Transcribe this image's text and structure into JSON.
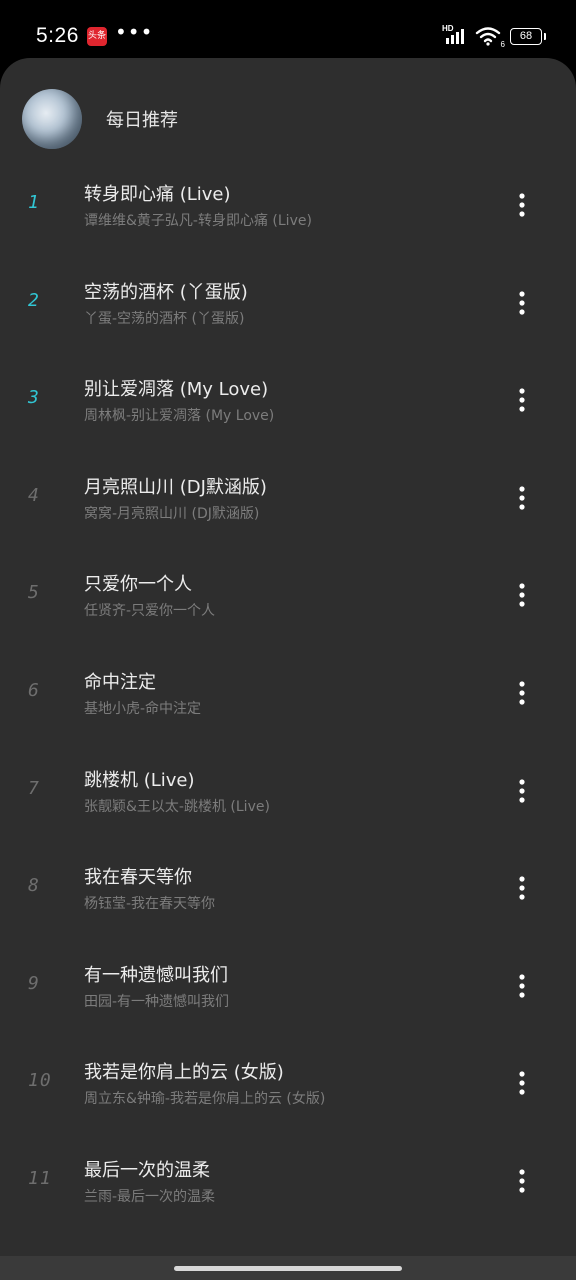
{
  "status_bar": {
    "time": "5:26",
    "app_icon_text": "头条",
    "dots": "•••",
    "network_label": "HD",
    "wifi_label": "6",
    "battery": "68"
  },
  "header": {
    "title": "每日推荐"
  },
  "songs": [
    {
      "index": "1",
      "title": "转身即心痛 (Live)",
      "subtitle": "谭维维&黄子弘凡-转身即心痛 (Live)"
    },
    {
      "index": "2",
      "title": "空荡的酒杯 (丫蛋版)",
      "subtitle": "丫蛋-空荡的酒杯 (丫蛋版)"
    },
    {
      "index": "3",
      "title": "别让爱凋落 (My Love)",
      "subtitle": "周林枫-别让爱凋落 (My Love)"
    },
    {
      "index": "4",
      "title": "月亮照山川 (DJ默涵版)",
      "subtitle": "窝窝-月亮照山川 (DJ默涵版)"
    },
    {
      "index": "5",
      "title": "只爱你一个人",
      "subtitle": "任贤齐-只爱你一个人"
    },
    {
      "index": "6",
      "title": "命中注定",
      "subtitle": "基地小虎-命中注定"
    },
    {
      "index": "7",
      "title": "跳楼机 (Live)",
      "subtitle": "张靓颖&王以太-跳楼机 (Live)"
    },
    {
      "index": "8",
      "title": "我在春天等你",
      "subtitle": "杨钰莹-我在春天等你"
    },
    {
      "index": "9",
      "title": "有一种遗憾叫我们",
      "subtitle": "田园-有一种遗憾叫我们"
    },
    {
      "index": "10",
      "title": "我若是你肩上的云 (女版)",
      "subtitle": "周立东&钟瑜-我若是你肩上的云 (女版)"
    },
    {
      "index": "11",
      "title": "最后一次的温柔",
      "subtitle": "兰雨-最后一次的温柔"
    }
  ],
  "colors": {
    "accent": "#31c6d4",
    "sheet_bg": "#2e2e2e",
    "index_gray": "#6e6e6e"
  },
  "icons": {
    "more": "more-vertical-icon",
    "signal": "signal-icon",
    "wifi": "wifi-icon",
    "battery": "battery-icon"
  }
}
